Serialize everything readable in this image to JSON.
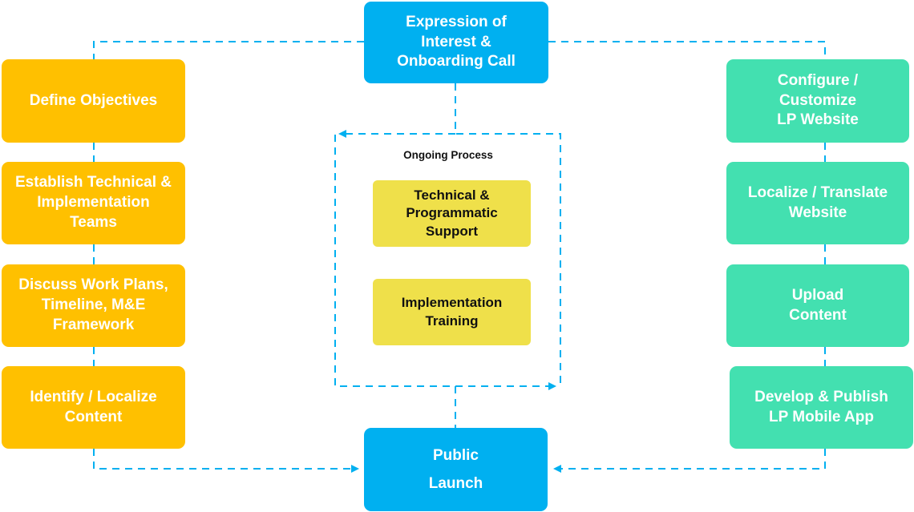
{
  "diagram": {
    "colors": {
      "start_end": "#00b0f0",
      "left_track": "#ffc000",
      "right_track": "#43e0b0",
      "ongoing": "#efe04a",
      "connector": "#00b0f0"
    },
    "start": {
      "label": "Expression of\nInterest &\nOnboarding Call"
    },
    "end": {
      "label": "Public\nLaunch"
    },
    "left_steps": [
      {
        "label": "Define Objectives"
      },
      {
        "label": "Establish Technical &\nImplementation\nTeams"
      },
      {
        "label": "Discuss Work Plans,\nTimeline, M&E\nFramework"
      },
      {
        "label": "Identify / Localize\nContent"
      }
    ],
    "right_steps": [
      {
        "label": "Configure /\nCustomize\nLP Website"
      },
      {
        "label": "Localize / Translate\nWebsite"
      },
      {
        "label": "Upload\nContent"
      },
      {
        "label": "Develop & Publish\nLP Mobile App"
      }
    ],
    "ongoing": {
      "title": "Ongoing Process",
      "items": [
        {
          "label": "Technical &\nProgrammatic\nSupport"
        },
        {
          "label": "Implementation\nTraining"
        }
      ]
    }
  }
}
